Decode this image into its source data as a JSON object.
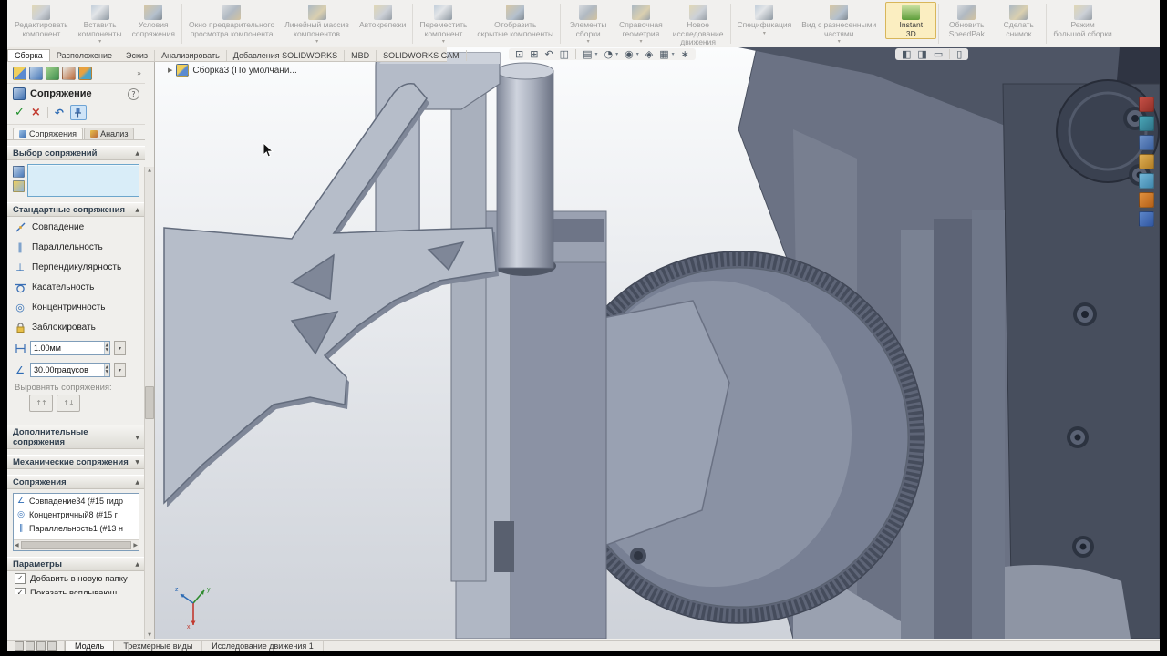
{
  "colors": {
    "panel_bg": "#f0efec",
    "ribbon_bg": "#f1f0ee",
    "selection_blue": "#d9edf8",
    "viewport_top": "#fbfcfd",
    "viewport_bottom": "#ced2d9",
    "frame_black": "#000000",
    "ok_green": "#1e8f2a",
    "cancel_red": "#c23a2f",
    "accent_blue": "#2d6bb4"
  },
  "glyphs": {
    "dropdown": "▾",
    "expander": "▶",
    "help": "?",
    "ok": "✓",
    "cancel": "×",
    "undo": "↶",
    "collapse": "▲",
    "expand": "▼",
    "parallel": "∥",
    "perpendicular": "⊥",
    "concentric": "◎",
    "angle": "∠",
    "aligned": "↑↑",
    "anti_aligned": "↑↓",
    "spin_up": "▲",
    "spin_down": "▼",
    "scroll_left": "◀",
    "scroll_right": "▶",
    "more": "»",
    "checkbox_check": "✓",
    "list_coincident": "∠",
    "list_concentric": "◎",
    "list_parallel": "∥"
  },
  "ribbon": {
    "items": [
      {
        "label": "Редактировать\nкомпонент"
      },
      {
        "label": "Вставить\nкомпоненты",
        "dropdown": true
      },
      {
        "label": "Условия\nсопряжения"
      },
      {
        "label": "Окно предварительного\nпросмотра компонента"
      },
      {
        "label": "Линейный массив\nкомпонентов",
        "dropdown": true
      },
      {
        "label": "Автокрепежи"
      },
      {
        "label": "Переместить\nкомпонент",
        "dropdown": true
      },
      {
        "label": "Отобразить\nскрытые компоненты"
      },
      {
        "label": "Элементы\nсборки",
        "dropdown": true
      },
      {
        "label": "Справочная\nгеометрия",
        "dropdown": true
      },
      {
        "label": "Новое\nисследование\nдвижения"
      },
      {
        "label": "Спецификация",
        "dropdown": true
      },
      {
        "label": "Вид с разнесенными\nчастями",
        "dropdown": true
      },
      {
        "label": "Instant\n3D",
        "active": true
      },
      {
        "label": "Обновить\nSpeedPak"
      },
      {
        "label": "Сделать\nснимок"
      },
      {
        "label": "Режим\nбольшой сборки"
      }
    ]
  },
  "tabs": [
    "Сборка",
    "Расположение",
    "Эскиз",
    "Анализировать",
    "Добавления SOLIDWORKS",
    "MBD",
    "SOLIDWORKS CAM"
  ],
  "hud": {
    "main": [
      "⊡",
      "⊞",
      "↶",
      "◫",
      "▤",
      "◔",
      "◉",
      "◈",
      "▦",
      "∗"
    ],
    "right": [
      "◧",
      "◨",
      "▭",
      "▯"
    ]
  },
  "feature_tree": {
    "root_label": "Сборка3 (По умолчани..."
  },
  "panel": {
    "title": "Сопряжение",
    "subtabs": [
      {
        "label": "Сопряжения"
      },
      {
        "label": "Анализ"
      }
    ],
    "selections": {
      "title": "Выбор сопряжений"
    },
    "standard": {
      "title": "Стандартные сопряжения",
      "mates": [
        "Совпадение",
        "Параллельность",
        "Перпендикулярность",
        "Касательность",
        "Концентричность",
        "Заблокировать"
      ],
      "distance_value": "1.00мм",
      "angle_value": "30.00градусов",
      "align_label": "Выровнять сопряжения:"
    },
    "advanced_title": "Дополнительные сопряжения",
    "mechanical_title": "Механические сопряжения",
    "mates_section": {
      "title": "Сопряжения",
      "items": [
        "Совпадение34 (#15 гидр",
        "Концентричный8 (#15 г",
        "Параллельность1 (#13 н"
      ]
    },
    "parameters": {
      "title": "Параметры",
      "option1": "Добавить в новую папку",
      "option2": "Показать всплывающ"
    }
  },
  "viewport": {
    "triad": {
      "x": "x",
      "y": "y",
      "z": "z"
    }
  },
  "statusbar": {
    "tabs": [
      "Модель",
      "Трехмерные виды",
      "Исследование движения 1"
    ]
  }
}
